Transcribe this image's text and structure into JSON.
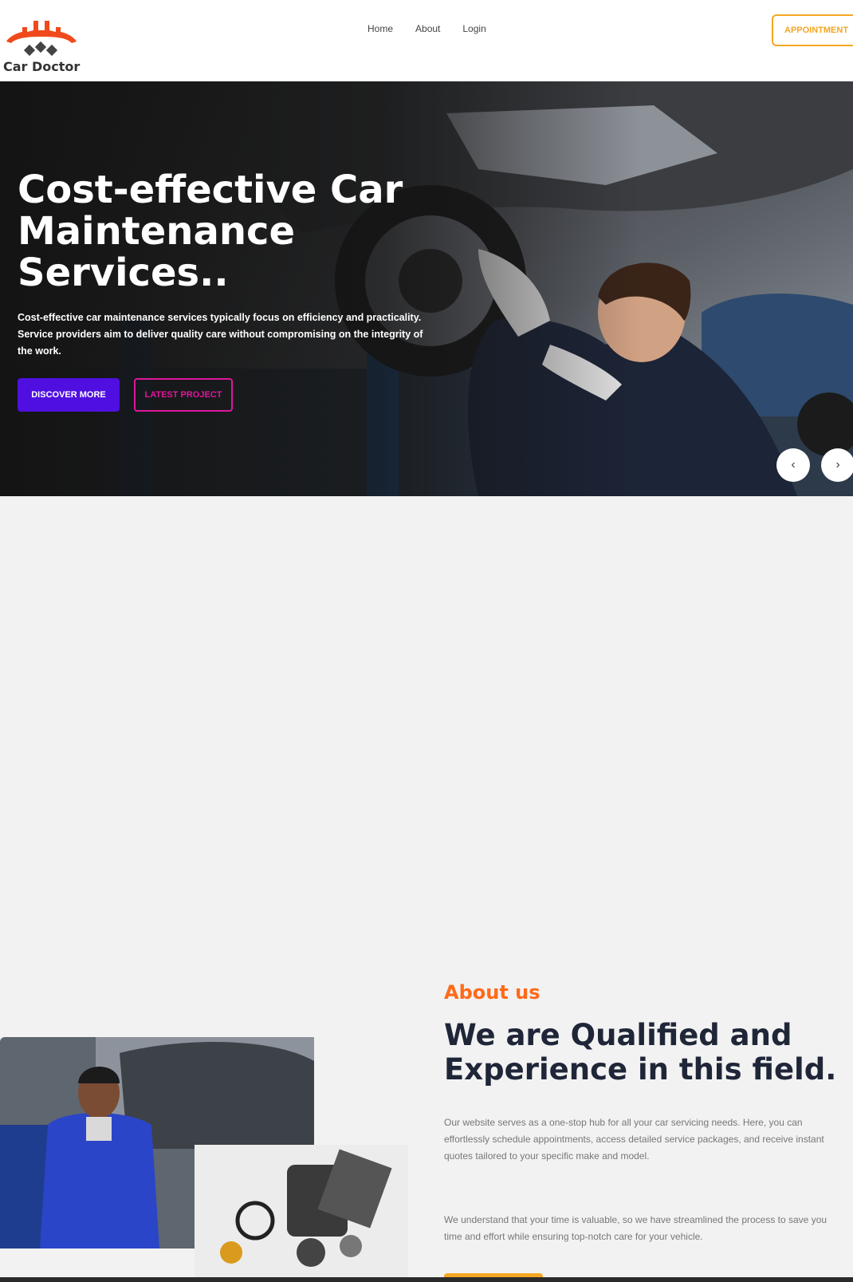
{
  "header": {
    "logo_text": "Car Doctor",
    "nav": [
      "Home",
      "About",
      "Login"
    ],
    "appointment_label": "APPOINTMENT"
  },
  "hero": {
    "title": "Cost-effective Car Maintenance Services..",
    "description": "Cost-effective car maintenance services typically focus on efficiency and practicality. Service providers aim to deliver quality care without compromising on the integrity of the work.",
    "discover_label": "DISCOVER MORE",
    "latest_label": "LATEST PROJECT",
    "prev_icon": "‹",
    "next_icon": "›"
  },
  "about": {
    "subtitle": "About us",
    "title": "We are Qualified and Experience in this field.",
    "paragraph1": "Our website serves as a one-stop hub for all your car servicing needs. Here, you can effortlessly schedule appointments, access detailed service packages, and receive instant quotes tailored to your specific make and model.",
    "paragraph2": "We understand that your time is valuable, so we have streamlined the process to save you time and effort while ensuring top-notch care for your vehicle."
  },
  "colors": {
    "accent_orange": "#f5a623",
    "about_orange": "#ff6a1a",
    "discover_purple": "#4f0fe0",
    "latest_pink": "#e0169b",
    "logo_red": "#f04a1c"
  },
  "icons": [
    "gear-logo-icon",
    "chevron-left-icon",
    "chevron-right-icon"
  ]
}
